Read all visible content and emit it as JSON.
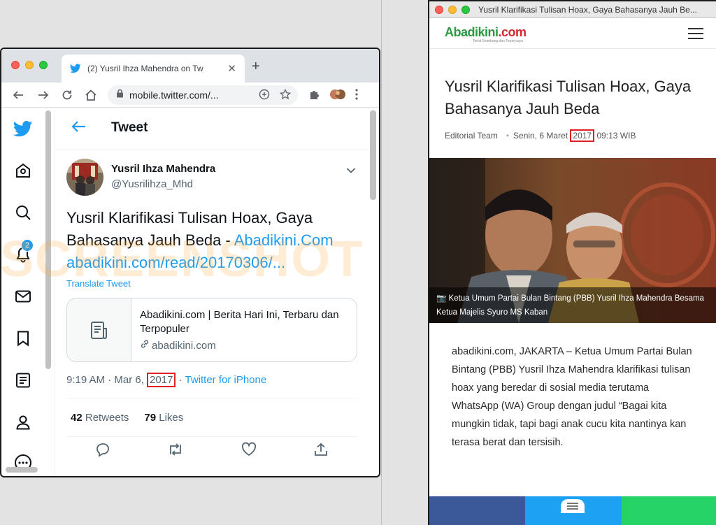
{
  "left_window": {
    "tab_title": "(2) Yusril Ihza Mahendra on Tw",
    "url": "mobile.twitter.com/...",
    "page_heading": "Tweet",
    "notification_count": "2",
    "author": {
      "name": "Yusril Ihza Mahendra",
      "handle": "@Yusrilihza_Mhd"
    },
    "tweet_text": "Yusril Klarifikasi Tulisan Hoax, Gaya Bahasanya Jauh Beda - ",
    "tweet_link_1": "Abadikini.Com",
    "tweet_link_2": "abadikini.com/read/20170306/...",
    "translate_label": "Translate Tweet",
    "card": {
      "title": "Abadikini.com | Berita Hari Ini, Terbaru dan Terpopuler",
      "domain": "abadikini.com"
    },
    "meta": {
      "prefix": "9:19 AM · Mar 6, ",
      "year": "2017",
      "separator": " · ",
      "source": "Twitter for iPhone"
    },
    "stats": {
      "retweets_count": "42",
      "retweets_label": "Retweets",
      "likes_count": "79",
      "likes_label": "Likes"
    }
  },
  "watermark": "SCREENSHOT",
  "right_window": {
    "window_title": "Yusril Klarifikasi Tulisan Hoax, Gaya Bahasanya Jauh Be...",
    "logo_main": "Abadikini",
    "logo_suffix": ".com",
    "logo_tagline": "Terbit Seimbang dan Terpercaya",
    "article_title": "Yusril Klarifikasi Tulisan Hoax, Gaya Bahasanya Jauh Beda",
    "byline": {
      "author": "Editorial Team",
      "date_prefix": "Senin, 6 Maret ",
      "year": "2017",
      "time": " 09:13 WIB"
    },
    "photo_caption": "Ketua Umum Partai Bulan Bintang (PBB) Yusril Ihza Mahendra Besama Ketua Majelis Syuro MS Kaban",
    "body": "abadikini.com, JAKARTA – Ketua Umum Partai Bulan Bintang (PBB) Yusril Ihza Mahendra klarifikasi tulisan hoax yang beredar di sosial media terutama WhatsApp (WA) Group dengan judul “Bagai kita mungkin tidak, tapi bagi anak cucu kita nantinya kan terasa berat dan tersisih."
  },
  "colors": {
    "twitter_blue": "#1d9bf0",
    "highlight_red": "#e02020",
    "logo_green": "#2a9a3e",
    "logo_red": "#d6282c"
  }
}
